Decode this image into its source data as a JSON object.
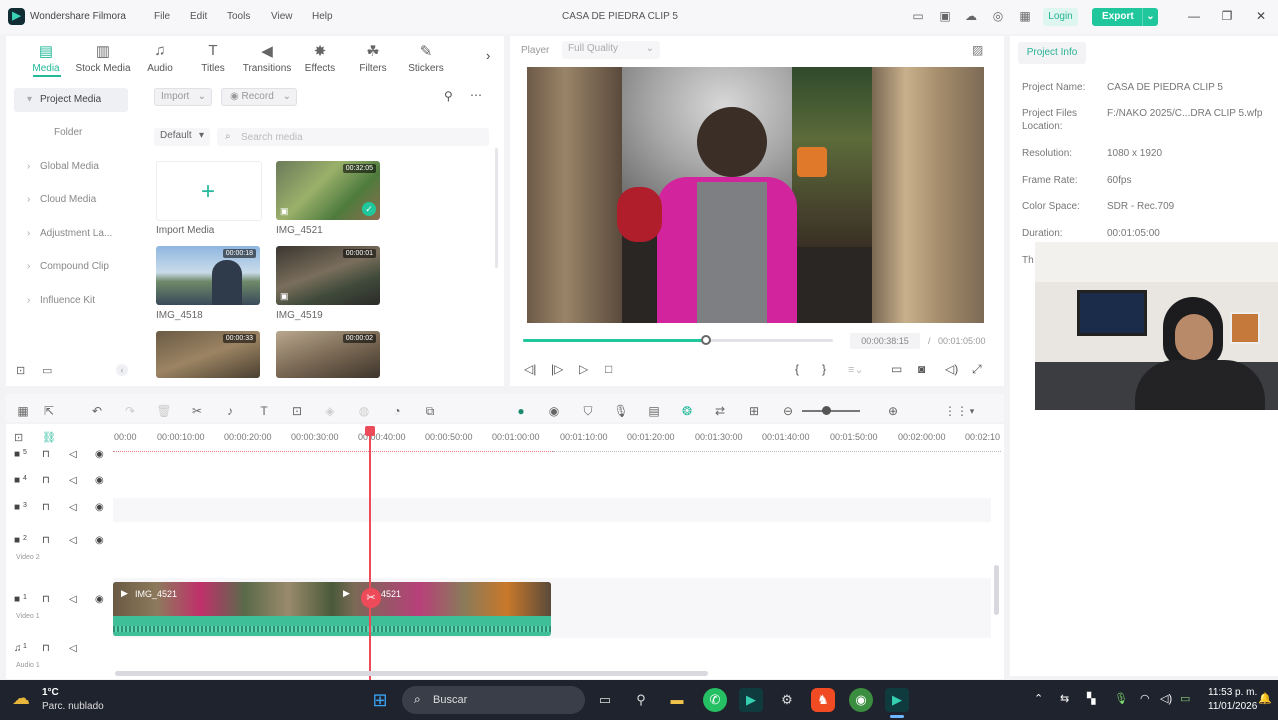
{
  "app": {
    "name": "Wondershare Filmora",
    "window_title": "CASA DE PIEDRA CLIP 5",
    "menu": [
      "File",
      "Edit",
      "Tools",
      "View",
      "Help"
    ],
    "login_label": "Login",
    "export_label": "Export"
  },
  "media_tabs": [
    {
      "label": "Media",
      "icon": "media-icon",
      "active": true
    },
    {
      "label": "Stock Media",
      "icon": "stock-media-icon"
    },
    {
      "label": "Audio",
      "icon": "music-note-icon"
    },
    {
      "label": "Titles",
      "icon": "titles-icon"
    },
    {
      "label": "Transitions",
      "icon": "transitions-icon"
    },
    {
      "label": "Effects",
      "icon": "effects-icon"
    },
    {
      "label": "Filters",
      "icon": "filters-icon"
    },
    {
      "label": "Stickers",
      "icon": "stickers-icon"
    }
  ],
  "sidebar": {
    "items": [
      "Project Media",
      "Folder",
      "Global Media",
      "Cloud Media",
      "Adjustment La...",
      "Compound Clip",
      "Influence Kit"
    ]
  },
  "media_toolbar": {
    "import_label": "Import",
    "record_label": "Record",
    "sort_label": "Default",
    "search_placeholder": "Search media"
  },
  "media_items": [
    {
      "name": "Import Media"
    },
    {
      "name": "IMG_4521",
      "duration": "00:32:05"
    },
    {
      "name": "IMG_4518",
      "duration": "00:00:18"
    },
    {
      "name": "IMG_4519",
      "duration": "00:00:01"
    },
    {
      "name": "",
      "duration": "00:00:33"
    },
    {
      "name": "",
      "duration": "00:00:02"
    }
  ],
  "player": {
    "label": "Player",
    "quality": "Full Quality",
    "current_time": "00:00:38:15",
    "separator": "/",
    "total_time": "00:01:05:00",
    "progress": 0.59
  },
  "project_info": {
    "tab": "Project Info",
    "rows": [
      {
        "key": "Project Name:",
        "value": "CASA DE PIEDRA CLIP 5"
      },
      {
        "key": "Project Files Location:",
        "value": "F:/NAKO 2025/C...DRA CLIP 5.wfp"
      },
      {
        "key": "Resolution:",
        "value": "1080 x 1920"
      },
      {
        "key": "Frame Rate:",
        "value": "60fps"
      },
      {
        "key": "Color Space:",
        "value": "SDR - Rec.709"
      },
      {
        "key": "Duration:",
        "value": "00:01:05:00"
      },
      {
        "key": "Th",
        "value": ""
      }
    ]
  },
  "timeline": {
    "ruler": [
      "00:00",
      "00:00:10:00",
      "00:00:20:00",
      "00:00:30:00",
      "00:00:40:00",
      "00:00:50:00",
      "00:01:00:00",
      "00:01:10:00",
      "00:01:20:00",
      "00:01:30:00",
      "00:01:40:00",
      "00:01:50:00",
      "00:02:00:00",
      "00:02:10"
    ],
    "tracks": [
      {
        "num": "5",
        "label": ""
      },
      {
        "num": "4",
        "label": ""
      },
      {
        "num": "3",
        "label": ""
      },
      {
        "num": "2",
        "label": "Video 2"
      },
      {
        "num": "1",
        "label": "Video 1"
      },
      {
        "num": "1",
        "label": "Audio 1"
      }
    ],
    "clips": [
      {
        "name": "IMG_4521"
      },
      {
        "name": "4521"
      }
    ]
  },
  "taskbar": {
    "weather_temp": "1°C",
    "weather_desc": "Parc. nublado",
    "search_label": "Buscar",
    "time": "11:53 p. m.",
    "date": "11/01/2026"
  },
  "colors": {
    "accent": "#21c79c",
    "playhead": "#ee4b5a",
    "taskbar": "#1f232e"
  }
}
